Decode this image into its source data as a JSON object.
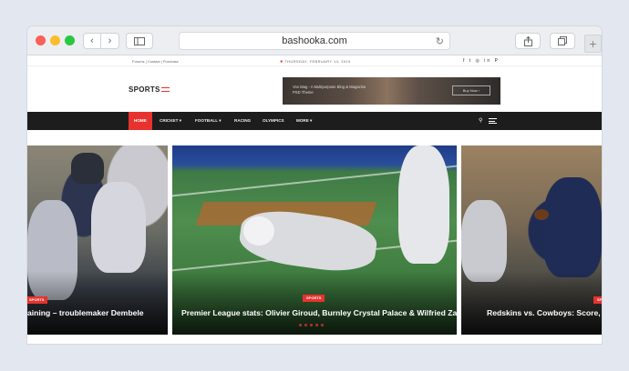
{
  "browser": {
    "url": "bashooka.com",
    "back_icon": "‹",
    "forward_icon": "›",
    "reload_icon": "↻",
    "new_tab_icon": "+"
  },
  "topbar": {
    "links": "Forums  |  Contact  |  Purchase",
    "date": "THURSDAY, FEBRUARY 14, 2019",
    "social_icons": "f  t  ◎  in  P"
  },
  "header": {
    "logo": "SPORTS",
    "banner_text": "Vox Mag - A Multipurpose Blog & Magazine PSD Theme",
    "banner_button": "Buy Now  ›"
  },
  "nav": {
    "items": [
      {
        "label": "HOME"
      },
      {
        "label": "CRICKET  ▾"
      },
      {
        "label": "FOOTBALL  ▾"
      },
      {
        "label": "RACING"
      },
      {
        "label": "OLYMPICS"
      },
      {
        "label": "MORE  ▾"
      }
    ]
  },
  "slider": {
    "slides": [
      {
        "category": "SPORTS",
        "title": "aining – troublemaker Dembele"
      },
      {
        "category": "SPORTS",
        "title": "Premier League stats: Olivier Giroud, Burnley Crystal Palace & Wilfried Zaha"
      },
      {
        "category": "SPORTS",
        "title": "Redskins vs. Cowboys: Score, res"
      }
    ],
    "dot_count": 5
  },
  "colors": {
    "accent": "#e8322e",
    "navbar": "#1d1d1d"
  }
}
